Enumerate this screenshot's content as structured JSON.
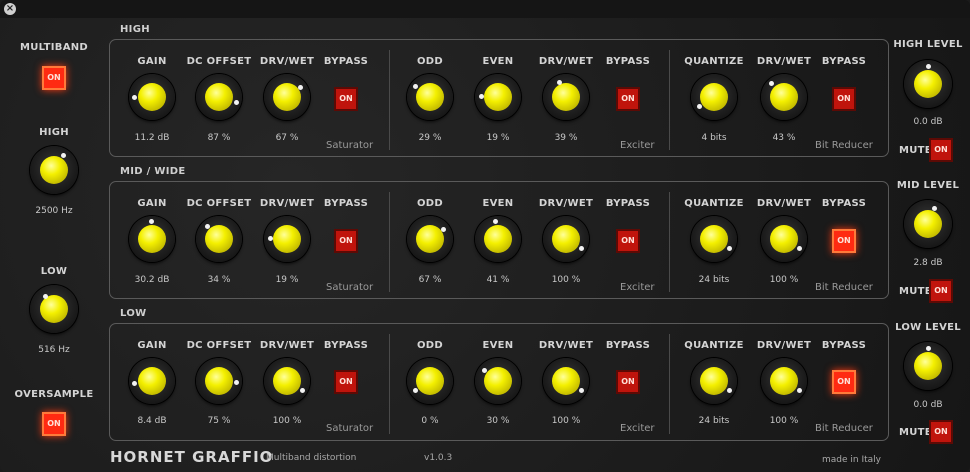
{
  "window": {
    "close_glyph": "×"
  },
  "left": {
    "multiband": {
      "label": "MULTIBAND",
      "button": "ON"
    },
    "high": {
      "label": "HIGH",
      "value": "2500 Hz"
    },
    "low": {
      "label": "LOW",
      "value": "516 Hz"
    },
    "oversample": {
      "label": "OVERSAMPLE",
      "button": "ON"
    }
  },
  "bands": [
    {
      "title": "HIGH",
      "saturator": {
        "gain": "11.2 dB",
        "dc_offset": "87 %",
        "drv_wet": "67 %",
        "bypass": "ON",
        "name": "Saturator"
      },
      "exciter": {
        "odd": "29 %",
        "even": "19 %",
        "drv_wet": "39 %",
        "bypass": "ON",
        "name": "Exciter"
      },
      "bitreducer": {
        "quantize": "4 bits",
        "drv_wet": "43 %",
        "bypass": "ON",
        "name": "Bit Reducer"
      },
      "level": {
        "label": "HIGH LEVEL",
        "value": "0.0 dB",
        "mute_label": "MUTE",
        "mute": "ON"
      }
    },
    {
      "title": "MID / WIDE",
      "saturator": {
        "gain": "30.2 dB",
        "dc_offset": "34 %",
        "drv_wet": "19 %",
        "bypass": "ON",
        "name": "Saturator"
      },
      "exciter": {
        "odd": "67 %",
        "even": "41 %",
        "drv_wet": "100 %",
        "bypass": "ON",
        "name": "Exciter"
      },
      "bitreducer": {
        "quantize": "24 bits",
        "drv_wet": "100 %",
        "bypass": "ON",
        "name": "Bit Reducer"
      },
      "level": {
        "label": "MID LEVEL",
        "value": "2.8 dB",
        "mute_label": "MUTE",
        "mute": "ON"
      }
    },
    {
      "title": "LOW",
      "saturator": {
        "gain": "8.4 dB",
        "dc_offset": "75 %",
        "drv_wet": "100 %",
        "bypass": "ON",
        "name": "Saturator"
      },
      "exciter": {
        "odd": "0 %",
        "even": "30 %",
        "drv_wet": "100 %",
        "bypass": "ON",
        "name": "Exciter"
      },
      "bitreducer": {
        "quantize": "24 bits",
        "drv_wet": "100 %",
        "bypass": "ON",
        "name": "Bit Reducer"
      },
      "level": {
        "label": "LOW LEVEL",
        "value": "0.0 dB",
        "mute_label": "MUTE",
        "mute": "ON"
      }
    }
  ],
  "labels": {
    "gain": "GAIN",
    "dc_offset": "DC OFFSET",
    "drv_wet": "DRV/WET",
    "bypass": "BYPASS",
    "odd": "ODD",
    "even": "EVEN",
    "quantize": "QUANTIZE"
  },
  "footer": {
    "brand": "HORNET GRAFFIO",
    "subtitle": "Multiband distortion",
    "version": "v1.0.3",
    "made_in": "made in Italy"
  },
  "colors": {
    "knob_cap": "#f4f000",
    "button_red": "#c0140c",
    "button_lit": "#ff2a12"
  }
}
